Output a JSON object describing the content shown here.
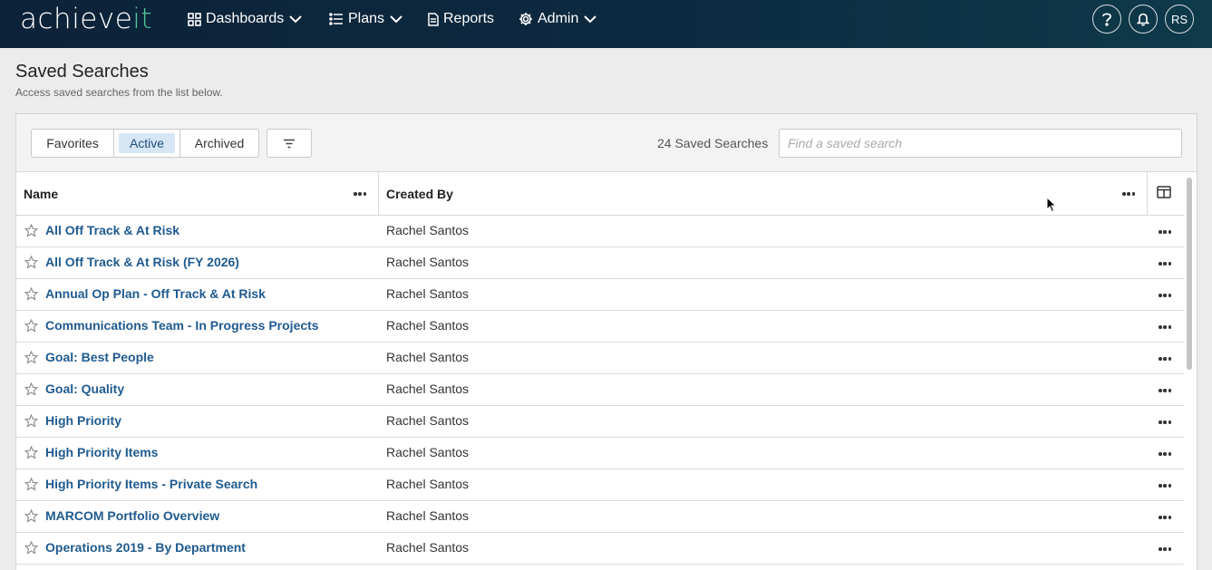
{
  "brand": {
    "logo_main": "achieve",
    "logo_accent": "it",
    "accent_color": "#52c39a"
  },
  "nav": {
    "dashboards": "Dashboards",
    "plans": "Plans",
    "reports": "Reports",
    "admin": "Admin",
    "help_icon": "question-icon",
    "bell_icon": "bell-icon",
    "user_initials": "RS"
  },
  "page": {
    "title": "Saved Searches",
    "subtitle": "Access saved searches from the list below."
  },
  "toolbar": {
    "tabs": {
      "favorites": "Favorites",
      "active": "Active",
      "archived": "Archived"
    },
    "selected_tab": "Active",
    "count_label": "24 Saved Searches",
    "search_placeholder": "Find a saved search"
  },
  "grid": {
    "columns": {
      "name": "Name",
      "created_by": "Created By"
    },
    "rows": [
      {
        "name": "All Off Track & At Risk",
        "created_by": "Rachel Santos"
      },
      {
        "name": "All Off Track & At Risk (FY 2026)",
        "created_by": "Rachel Santos"
      },
      {
        "name": "Annual Op Plan - Off Track & At Risk",
        "created_by": "Rachel Santos"
      },
      {
        "name": "Communications Team - In Progress Projects",
        "created_by": "Rachel Santos"
      },
      {
        "name": "Goal: Best People",
        "created_by": "Rachel Santos"
      },
      {
        "name": "Goal: Quality",
        "created_by": "Rachel Santos"
      },
      {
        "name": "High Priority",
        "created_by": "Rachel Santos"
      },
      {
        "name": "High Priority Items",
        "created_by": "Rachel Santos"
      },
      {
        "name": "High Priority Items - Private Search",
        "created_by": "Rachel Santos"
      },
      {
        "name": "MARCOM Portfolio Overview",
        "created_by": "Rachel Santos"
      },
      {
        "name": "Operations 2019 - By Department",
        "created_by": "Rachel Santos"
      }
    ]
  },
  "colors": {
    "nav_bg": "#0c2238",
    "link": "#1f5a8f",
    "active_tab_bg": "#d6e6f5"
  }
}
